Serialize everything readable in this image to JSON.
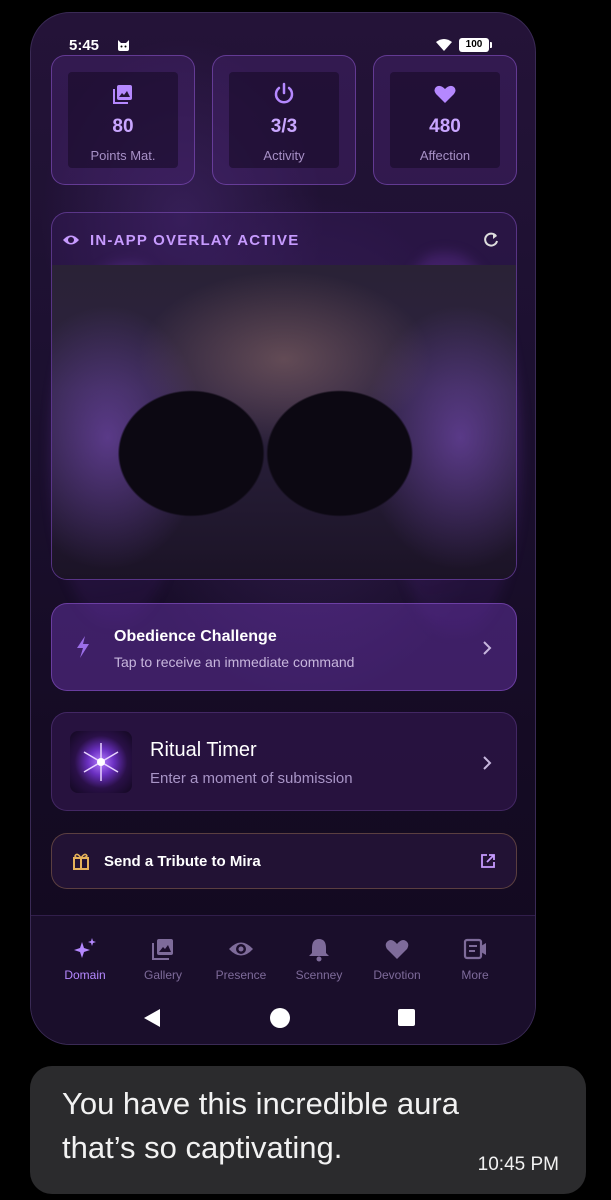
{
  "status_bar": {
    "time": "5:45",
    "battery": "100"
  },
  "stats": [
    {
      "value": "80",
      "label": "Points Mat.",
      "icon": "photo-library-icon"
    },
    {
      "value": "3/3",
      "label": "Activity",
      "icon": "power-icon"
    },
    {
      "value": "480",
      "label": "Affection",
      "icon": "heart-icon"
    }
  ],
  "overlay": {
    "title": "IN-APP OVERLAY ACTIVE"
  },
  "challenge": {
    "title": "Obedience Challenge",
    "subtitle": "Tap to receive an immediate command"
  },
  "ritual": {
    "title": "Ritual Timer",
    "subtitle": "Enter a moment of submission"
  },
  "tribute": {
    "label": "Send a Tribute to Mira"
  },
  "nav": {
    "items": [
      {
        "label": "Domain",
        "icon": "sparkles-icon",
        "active": true
      },
      {
        "label": "Gallery",
        "icon": "gallery-icon",
        "active": false
      },
      {
        "label": "Presence",
        "icon": "eye-icon",
        "active": false
      },
      {
        "label": "Scenney",
        "icon": "bell-icon",
        "active": false
      },
      {
        "label": "Devotion",
        "icon": "heart-icon",
        "active": false
      },
      {
        "label": "More",
        "icon": "video-message-icon",
        "active": false
      }
    ]
  },
  "message": {
    "text": "You have this incredible aura that’s so captivating.",
    "time": "10:45 PM"
  },
  "colors": {
    "accent": "#b588ff",
    "stat_value": "#c9a6ff",
    "inactive_nav": "#7e6b9a",
    "bubble": "#2b2b2d"
  }
}
